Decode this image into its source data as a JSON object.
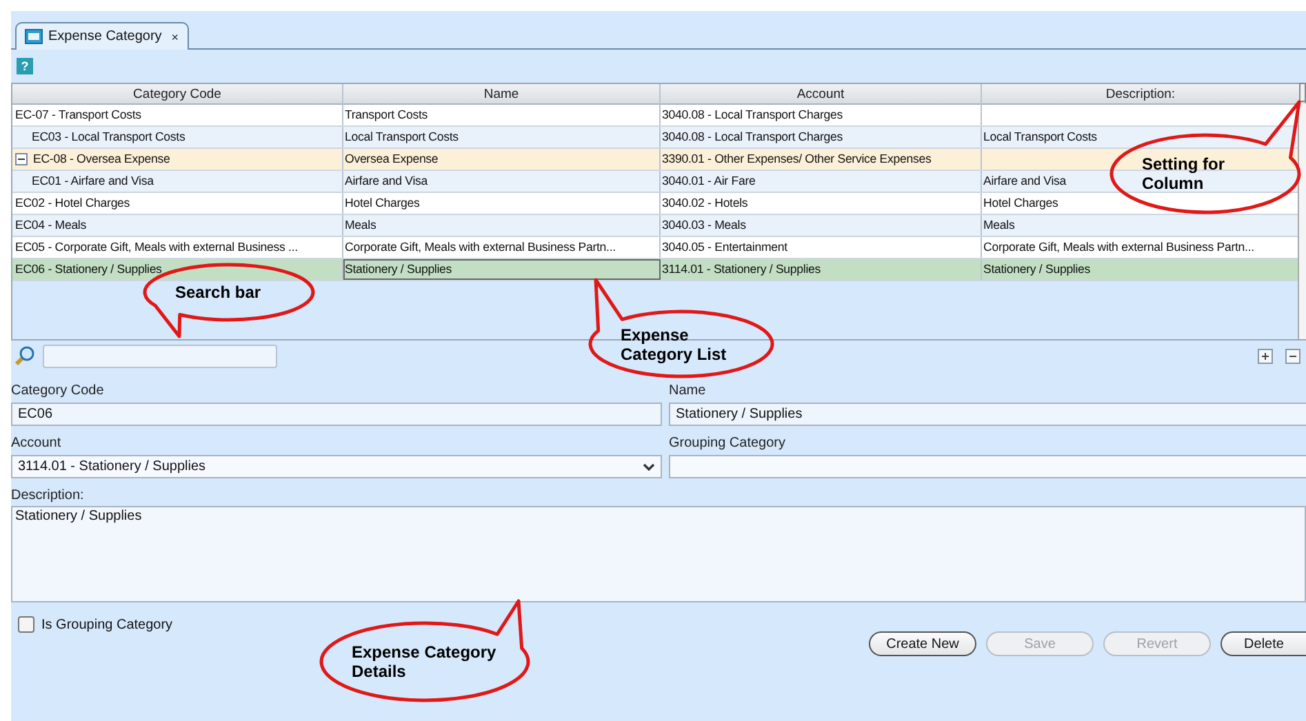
{
  "tab": {
    "label": "Expense Category",
    "selected": true,
    "close": "×"
  },
  "help": {
    "label": "?"
  },
  "table": {
    "columns": [
      "Category Code",
      "Name",
      "Account",
      "Description:"
    ],
    "rows": [
      {
        "category_code": "EC-07 - Transport Costs",
        "name": "Transport Costs",
        "account": "3040.08 - Local Transport Charges",
        "grouping": false,
        "selected": false,
        "children": [
          {
            "category_code": "EC03 - Local Transport Costs",
            "name": "Local Transport Costs",
            "account": "3040.08 - Local Transport Charges",
            "description": "Local Transport Costs",
            "grouping": false,
            "selected": false
          }
        ]
      },
      {
        "category_code": "EC-08 - Oversea Expense",
        "name": "Oversea Expense",
        "account": "3390.01 - Other Expenses/ Other Service Expenses",
        "grouping": true,
        "selected": false,
        "expanded": true,
        "children": [
          {
            "category_code": "EC01 - Airfare and Visa",
            "name": "Airfare and Visa",
            "account": "3040.01 - Air Fare",
            "description": "Airfare and Visa",
            "grouping": false,
            "selected": false
          }
        ]
      },
      {
        "category_code": "EC02 - Hotel Charges",
        "name": "Hotel Charges",
        "account": "3040.02 - Hotels",
        "description": "Hotel Charges",
        "grouping": false,
        "selected": false
      },
      {
        "category_code": "EC04 - Meals",
        "name": "Meals",
        "account": "3040.03 - Meals",
        "description": "Meals",
        "grouping": false,
        "selected": false
      },
      {
        "category_code": "EC05 - Corporate Gift, Meals with external Business ...",
        "name": "Corporate Gift, Meals with external Business Partn...",
        "account": "3040.05 - Entertainment",
        "description": "Corporate Gift, Meals with external Business Partn...",
        "grouping": false,
        "selected": false
      },
      {
        "category_code": "EC06 - Stationery / Supplies",
        "name": "Stationery / Supplies",
        "account": "3114.01 - Stationery / Supplies",
        "description": "Stationery / Supplies",
        "grouping": false,
        "selected": true
      }
    ]
  },
  "form": {
    "category_code": {
      "label": "Category Code",
      "value": "EC06"
    },
    "name": {
      "label": "Name",
      "value": "Stationery / Supplies"
    },
    "account": {
      "label": "Account",
      "value": "3114.01 - Stationery / Supplies"
    },
    "grouping_category": {
      "label": "Grouping Category"
    },
    "description": {
      "label": "Description:",
      "value": "Stationery / Supplies"
    },
    "is_grouping_category": {
      "label": "Is Grouping Category",
      "checked": false
    }
  },
  "buttons": [
    {
      "label": "Create New",
      "disabled": false
    },
    {
      "label": "Save",
      "disabled": true
    },
    {
      "label": "Revert",
      "disabled": true
    },
    {
      "label": "Delete",
      "disabled": false
    }
  ],
  "callouts": [
    "Search bar",
    "Expense Category List",
    "Setting for Column",
    "Expense Category Details"
  ]
}
